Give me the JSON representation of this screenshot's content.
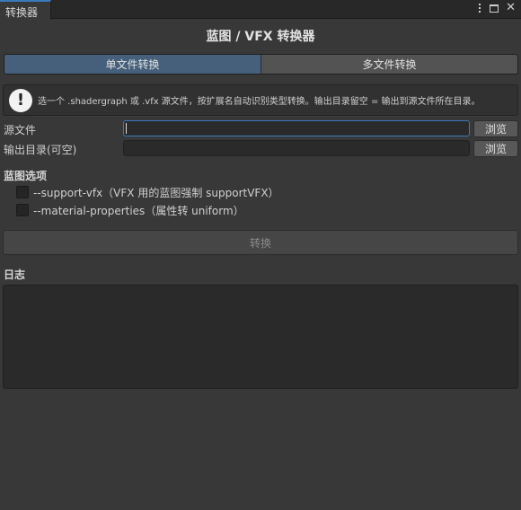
{
  "window": {
    "tab_title": "转换器",
    "icons": [
      "more-vertical-icon",
      "maximize-icon",
      "close-icon"
    ]
  },
  "header": {
    "title": "蓝图 / VFX 转换器"
  },
  "modes": [
    {
      "label": "单文件转换",
      "active": true
    },
    {
      "label": "多文件转换",
      "active": false
    }
  ],
  "help": {
    "icon": "info-exclamation-icon",
    "text": "选一个 .shadergraph 或 .vfx 源文件，按扩展名自动识别类型转换。输出目录留空 = 输出到源文件所在目录。"
  },
  "source": {
    "label": "源文件",
    "value": "",
    "browse_label": "浏览"
  },
  "output": {
    "label": "输出目录(可空)",
    "value": "",
    "browse_label": "浏览"
  },
  "options": {
    "title": "蓝图选项",
    "items": [
      {
        "label": "--support-vfx（VFX 用的蓝图强制 supportVFX）",
        "checked": false
      },
      {
        "label": "--material-properties（属性转 uniform）",
        "checked": false
      }
    ]
  },
  "actions": {
    "convert_label": "转换"
  },
  "log": {
    "title": "日志",
    "content": ""
  },
  "colors": {
    "accent": "#3a79bb",
    "active_tab": "#46607c",
    "background": "#383838"
  }
}
